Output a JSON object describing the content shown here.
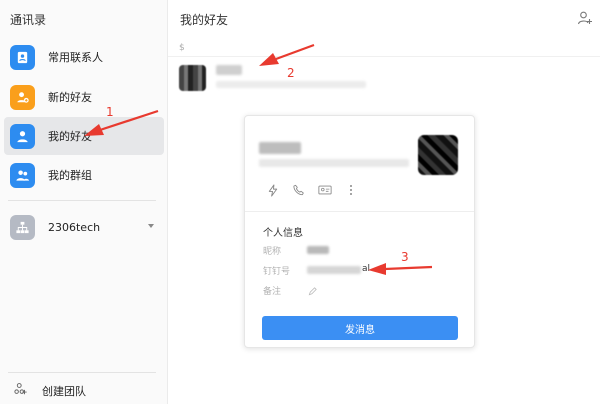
{
  "sidebar": {
    "title": "通讯录",
    "items": [
      {
        "label": "常用联系人",
        "icon": "contacts-book-icon",
        "color": "#2d8cf0"
      },
      {
        "label": "新的好友",
        "icon": "new-friend-icon",
        "color": "#fa9f1b"
      },
      {
        "label": "我的好友",
        "icon": "friend-icon",
        "color": "#2d8cf0",
        "active": true
      },
      {
        "label": "我的群组",
        "icon": "group-icon",
        "color": "#2d8cf0"
      }
    ],
    "org": {
      "label": "2306tech",
      "icon": "org-tree-icon",
      "color": "#b5bac4"
    },
    "footer": {
      "label": "创建团队",
      "icon": "create-team-icon"
    }
  },
  "main": {
    "title": "我的好友",
    "add_friend_icon": "add-friend-icon",
    "section_letter": "$"
  },
  "card": {
    "section_title": "个人信息",
    "fields": [
      {
        "label": "昵称"
      },
      {
        "label": "钉钉号",
        "value_tail": "al"
      },
      {
        "label": "备注",
        "icon": "edit-pencil-icon"
      }
    ],
    "actions": [
      "ding-lightning-icon",
      "phone-icon",
      "business-card-icon",
      "more-icon"
    ],
    "send_button": "发消息"
  },
  "annotations": {
    "numbers": [
      "1",
      "2",
      "3"
    ],
    "color": "#e83a2f"
  },
  "colors": {
    "accent": "#3b8ff3",
    "sidebar_bg": "#fafafa",
    "active_bg": "#e6e7e9"
  }
}
